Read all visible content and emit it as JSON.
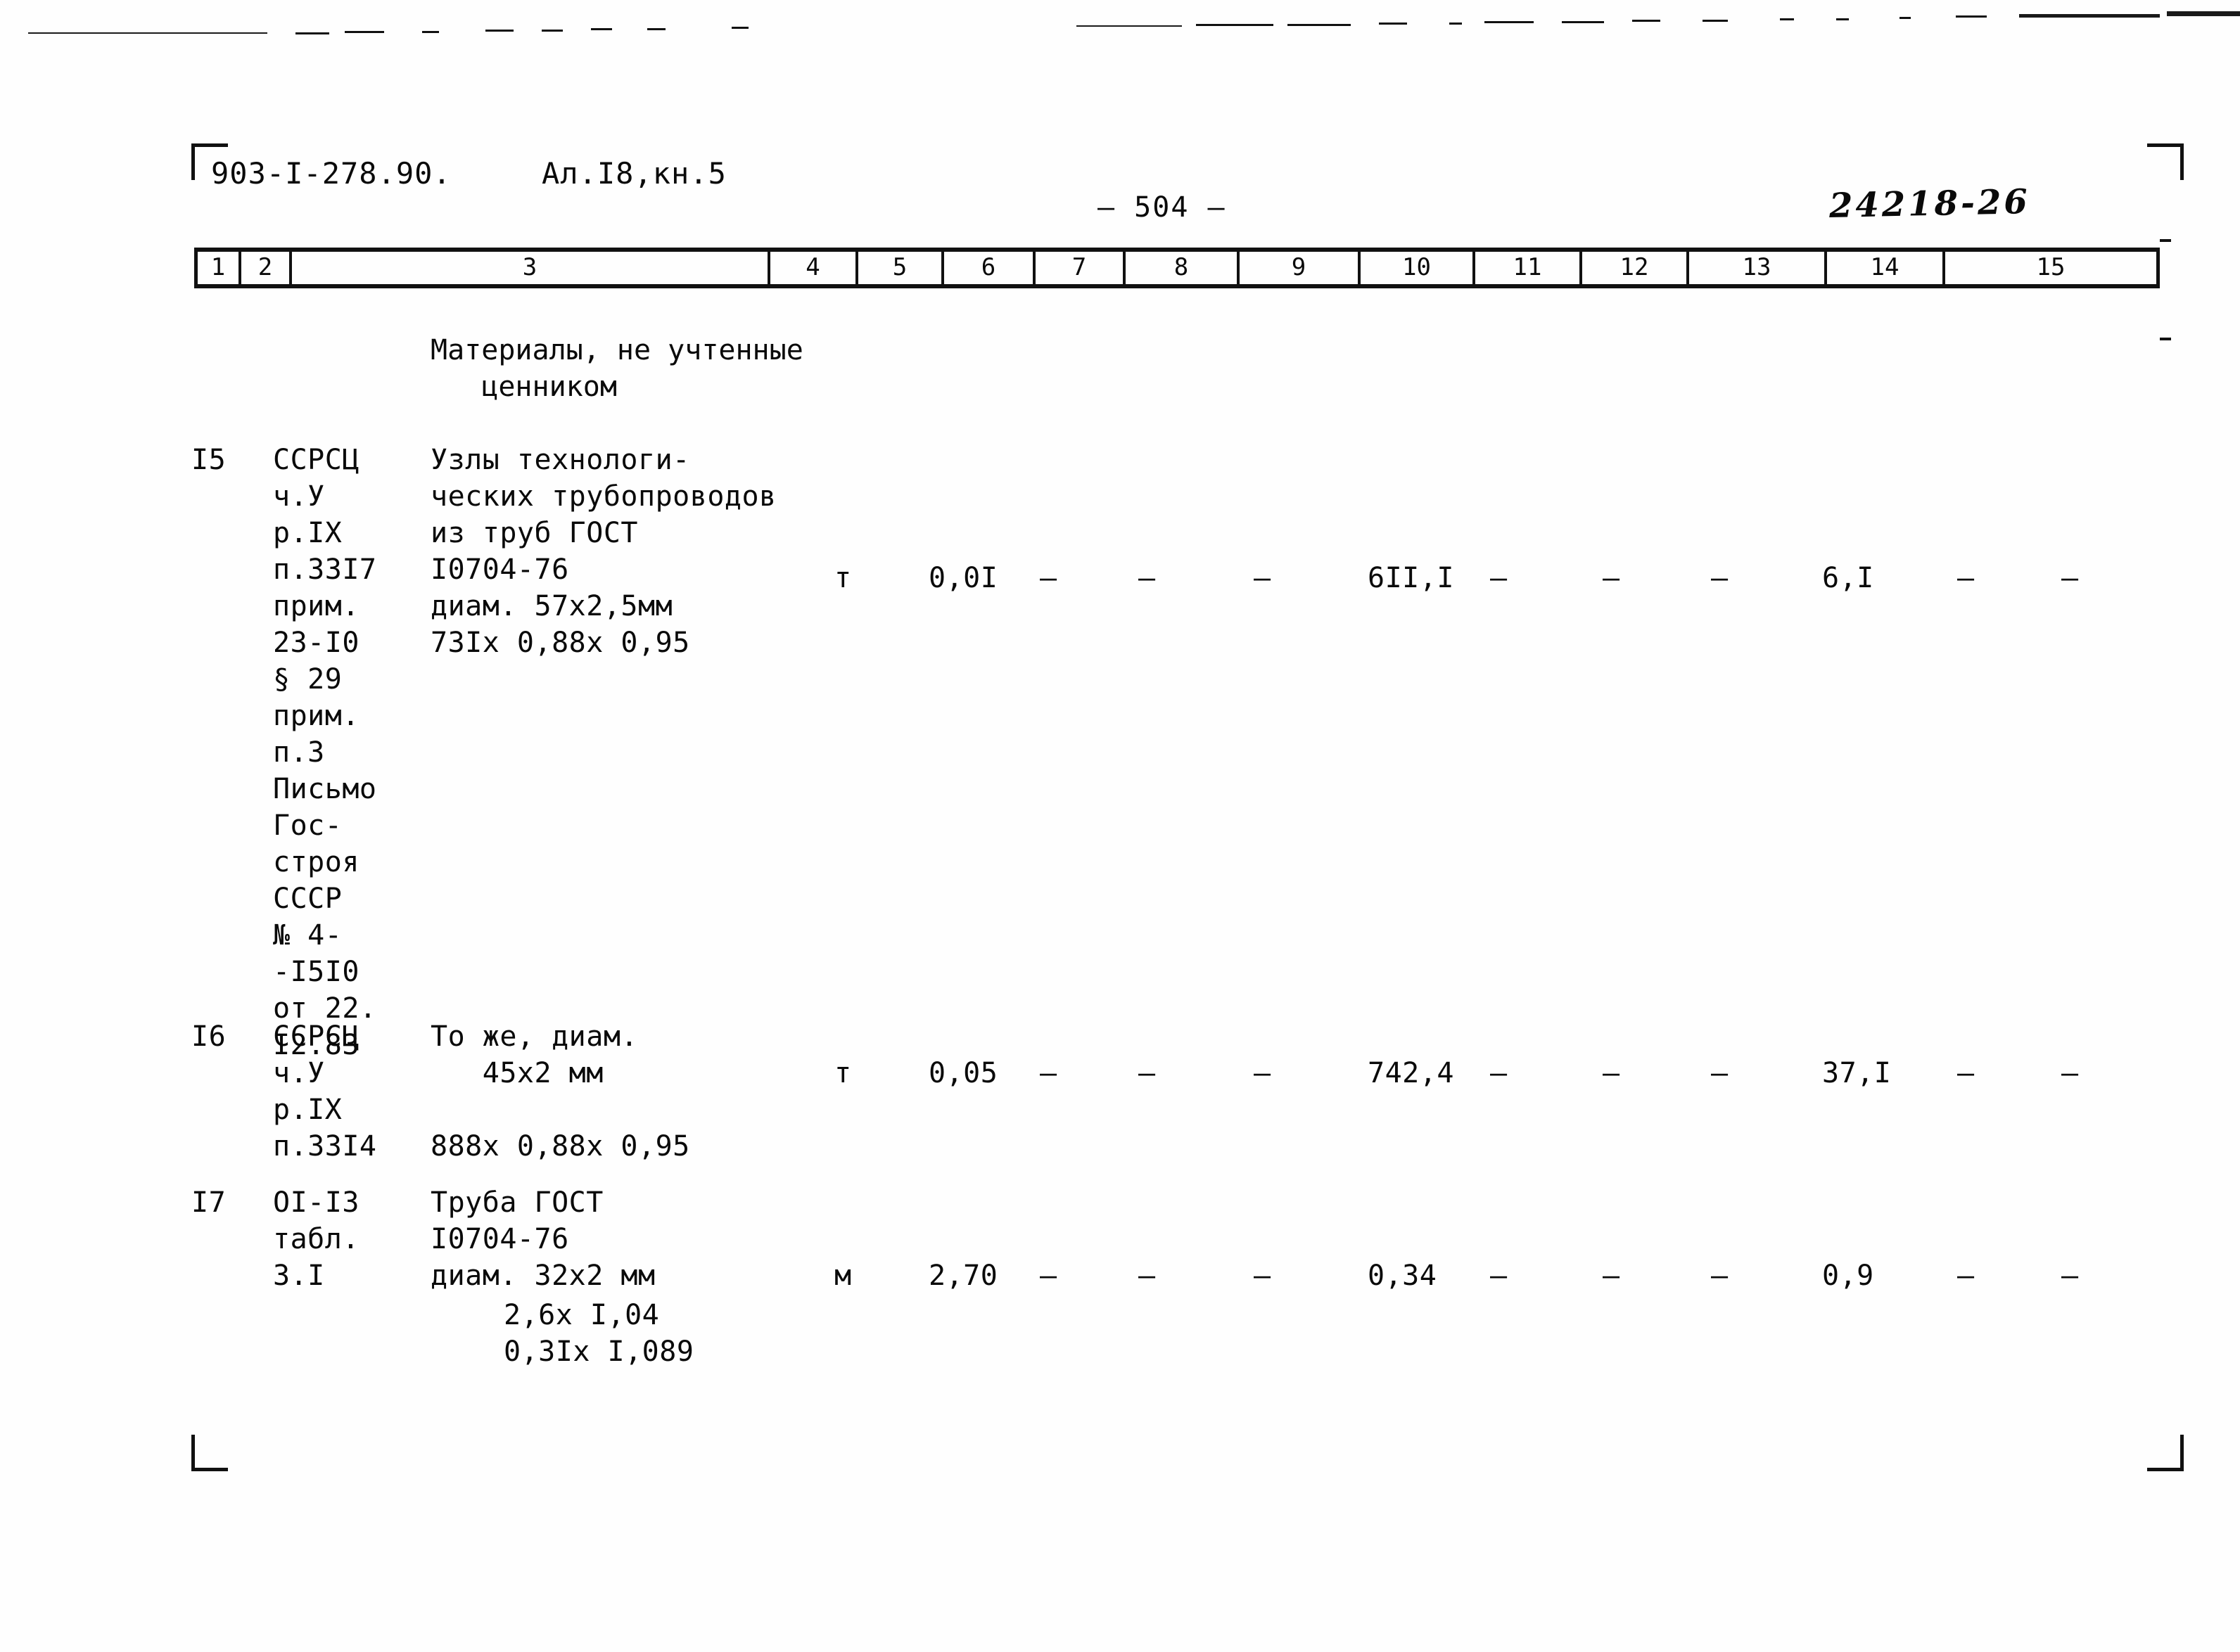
{
  "header": {
    "doc_code": "903-I-278.90.",
    "album": "Ал.I8,кн.5",
    "page_number": "— 504 —",
    "stamp": "24218-26"
  },
  "column_numbers": [
    "1",
    "2",
    "3",
    "4",
    "5",
    "6",
    "7",
    "8",
    "9",
    "10",
    "11",
    "12",
    "13",
    "14",
    "15"
  ],
  "section_title": "Материалы, не учтенные\n   ценником",
  "rows": [
    {
      "no": "I5",
      "code": "ССРСЦ\nч.У\nр.IХ\nп.33I7\nприм.\n23-I0\n§ 29\nприм.\nп.3\nПисьмо\nГос-\nстроя\nСССР\n№ 4-\n-I5I0\nот 22.\nI2.83",
      "description": "Узлы техноло­ги-\nческих трубопроводов\nиз труб ГОСТ\nI0704-76\nдиам. 57х2,5мм",
      "formula": "73Iх 0,88х 0,95",
      "unit": "т",
      "c5": "0,0I",
      "c6": "—",
      "c7": "—",
      "c8": "—",
      "c9": "6II,I",
      "c10": "—",
      "c11": "—",
      "c12": "—",
      "c13": "6,I",
      "c14": "—",
      "c15": "—"
    },
    {
      "no": "I6",
      "code": "ССРСЦ\nч.У\nр.IХ\nп.33I4",
      "description": "То же, диам.\n   45х2 мм",
      "formula": "888х 0,88х 0,95",
      "unit": "т",
      "c5": "0,05",
      "c6": "—",
      "c7": "—",
      "c8": "—",
      "c9": "742,4",
      "c10": "—",
      "c11": "—",
      "c12": "—",
      "c13": "37,I",
      "c14": "—",
      "c15": "—"
    },
    {
      "no": "I7",
      "code": "OI-I3\nтабл.\n3.I",
      "description": "Труба ГОСТ\nI0704-76\nдиам. 32х2 мм",
      "formula": "2,6х I,04\n0,3Iх I,089",
      "unit": "м",
      "c5": "2,70",
      "c6": "—",
      "c7": "—",
      "c8": "—",
      "c9": "0,34",
      "c10": "—",
      "c11": "—",
      "c12": "—",
      "c13": "0,9",
      "c14": "—",
      "c15": "—"
    }
  ]
}
